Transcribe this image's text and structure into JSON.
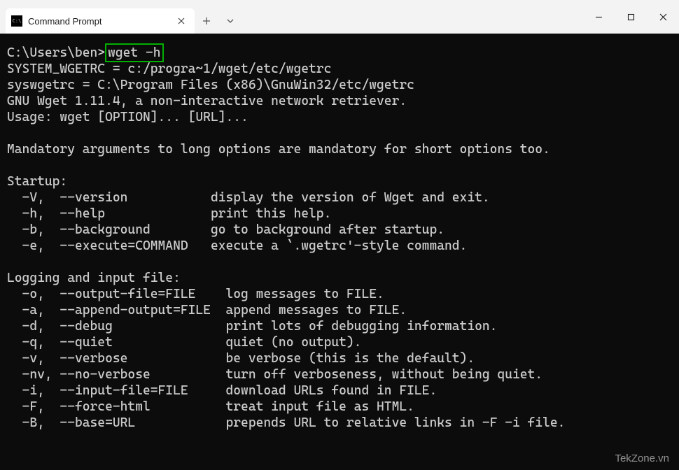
{
  "window": {
    "tab_title": "Command Prompt",
    "watermark": "TekZone.vn"
  },
  "terminal": {
    "prompt_prefix": "C:\\Users\\ben>",
    "command": "wget -h",
    "output_lines": [
      "SYSTEM_WGETRC = c:/progra~1/wget/etc/wgetrc",
      "syswgetrc = C:\\Program Files (x86)\\GnuWin32/etc/wgetrc",
      "GNU Wget 1.11.4, a non-interactive network retriever.",
      "Usage: wget [OPTION]... [URL]...",
      "",
      "Mandatory arguments to long options are mandatory for short options too.",
      "",
      "Startup:",
      "  -V,  --version           display the version of Wget and exit.",
      "  -h,  --help              print this help.",
      "  -b,  --background        go to background after startup.",
      "  -e,  --execute=COMMAND   execute a `.wgetrc'-style command.",
      "",
      "Logging and input file:",
      "  -o,  --output-file=FILE    log messages to FILE.",
      "  -a,  --append-output=FILE  append messages to FILE.",
      "  -d,  --debug               print lots of debugging information.",
      "  -q,  --quiet               quiet (no output).",
      "  -v,  --verbose             be verbose (this is the default).",
      "  -nv, --no-verbose          turn off verboseness, without being quiet.",
      "  -i,  --input-file=FILE     download URLs found in FILE.",
      "  -F,  --force-html          treat input file as HTML.",
      "  -B,  --base=URL            prepends URL to relative links in -F -i file."
    ]
  }
}
